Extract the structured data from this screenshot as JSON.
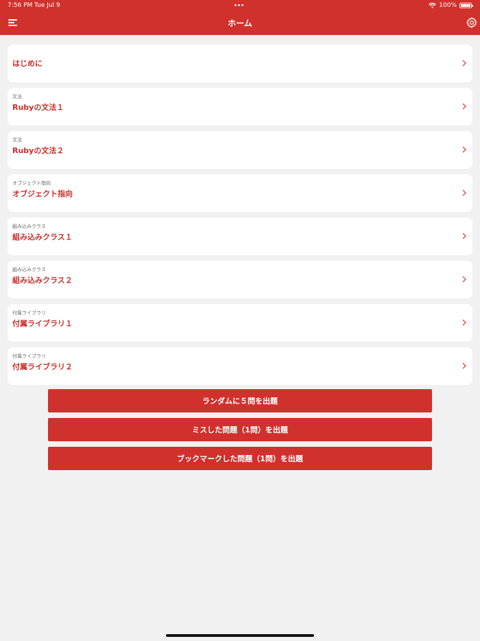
{
  "status_bar": {
    "time": "7:56 PM",
    "date": "Tue Jul 9",
    "battery": "100%"
  },
  "nav": {
    "title": "ホーム",
    "menu_icon": "menu-icon",
    "settings_icon": "gear-icon"
  },
  "sections": [
    {
      "category": "",
      "title": "はじめに"
    },
    {
      "category": "文法",
      "title": "Rubyの文法１"
    },
    {
      "category": "文法",
      "title": "Rubyの文法２"
    },
    {
      "category": "オブジェクト指向",
      "title": "オブジェクト指向"
    },
    {
      "category": "組み込みクラス",
      "title": "組み込みクラス１"
    },
    {
      "category": "組み込みクラス",
      "title": "組み込みクラス２"
    },
    {
      "category": "付属ライブラリ",
      "title": "付属ライブラリ１"
    },
    {
      "category": "付属ライブラリ",
      "title": "付属ライブラリ２"
    }
  ],
  "actions": {
    "random": "ランダムに５問を出題",
    "mistakes": "ミスした問題（1問）を出題",
    "bookmarks": "ブックマークした問題（1問）を出題"
  },
  "colors": {
    "accent": "#d0312d",
    "title_text": "#c8302c",
    "background": "#f1f1f1",
    "card": "#ffffff"
  }
}
